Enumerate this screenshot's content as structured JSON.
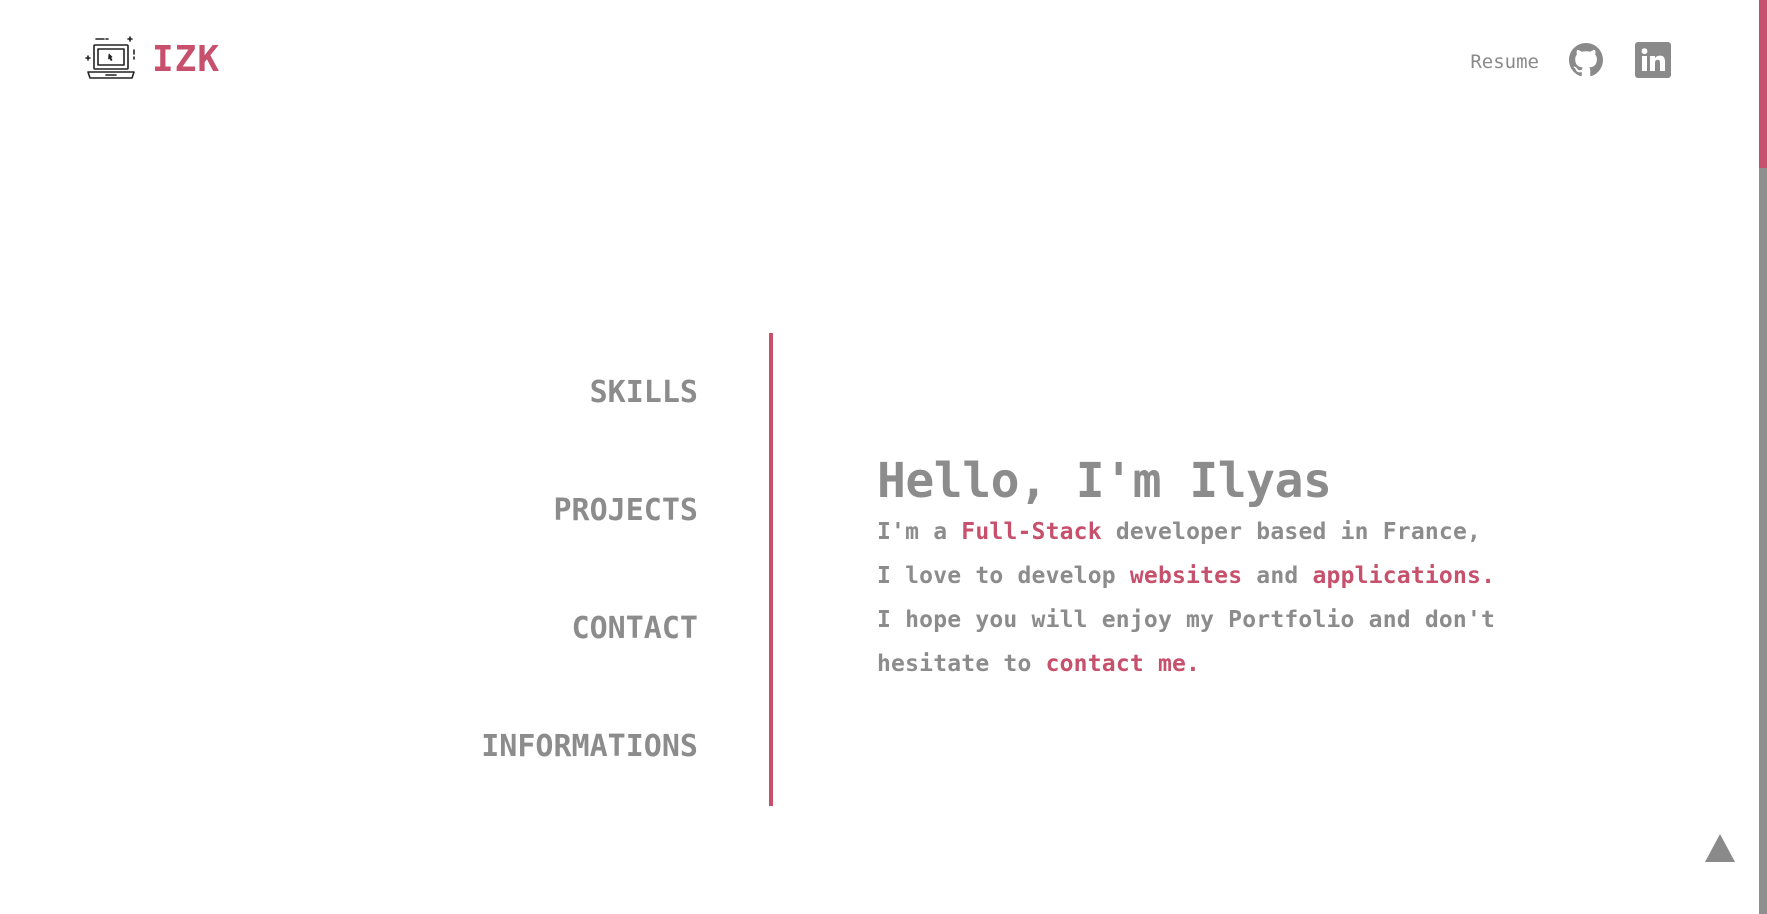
{
  "header": {
    "logo_text": "IZK",
    "resume_label": "Resume"
  },
  "nav": {
    "items": [
      {
        "label": "SKILLS"
      },
      {
        "label": "PROJECTS"
      },
      {
        "label": "CONTACT"
      },
      {
        "label": "INFORMATIONS"
      }
    ]
  },
  "intro": {
    "title": "Hello, I'm Ilyas",
    "line1": {
      "pre": "I'm a ",
      "highlight": "Full-Stack",
      "post": " developer based in France,"
    },
    "line2": {
      "pre": "I love to develop ",
      "highlight1": "websites",
      "mid": " and ",
      "highlight2": "applications."
    },
    "line3": {
      "text": "I hope you will enjoy my Portfolio and don't"
    },
    "line4": {
      "pre": "hesitate to ",
      "highlight": "contact me."
    }
  },
  "icons": {
    "logo": "laptop-icon",
    "github": "github-icon",
    "linkedin": "linkedin-icon",
    "scroll_top": "arrow-up-icon"
  },
  "colors": {
    "accent": "#c7506c",
    "text": "#8c8c8c",
    "background": "#ffffff",
    "scroll_track": "#8f8f8f"
  }
}
